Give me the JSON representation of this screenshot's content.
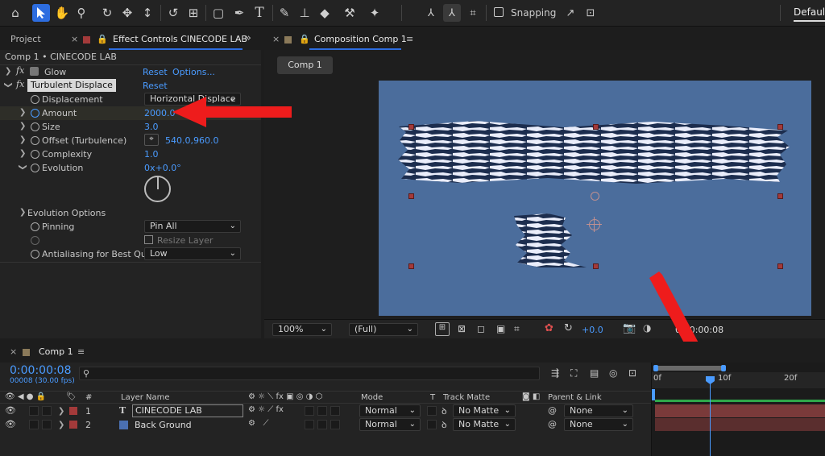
{
  "toolbar": {
    "snapping_label": "Snapping",
    "workspace": "Default",
    "tools": [
      "home-icon",
      "selection-icon",
      "hand-icon",
      "zoom-icon",
      "orbit-icon",
      "pan-icon",
      "dolly-icon",
      "rotate-icon",
      "pan-behind-icon",
      "rectangle-icon",
      "pen-icon",
      "type-icon",
      "brush-icon",
      "clone-stamp-icon",
      "eraser-icon",
      "roto-icon",
      "puppet-icon"
    ]
  },
  "left_panel": {
    "tab_project": "Project",
    "tab_effect": "Effect Controls CINECODE LAB",
    "breadcrumb": "Comp 1 • CINECODE LAB",
    "effects": [
      {
        "name": "Glow",
        "reset": "Reset",
        "options": "Options..."
      },
      {
        "name": "Turbulent Displace",
        "reset": "Reset"
      }
    ],
    "props": {
      "displacement_label": "Displacement",
      "displacement_value": "Horizontal Displace",
      "amount_label": "Amount",
      "amount_value": "2000.0",
      "size_label": "Size",
      "size_value": "3.0",
      "offset_label": "Offset (Turbulence)",
      "offset_value": "540.0,960.0",
      "complexity_label": "Complexity",
      "complexity_value": "1.0",
      "evolution_label": "Evolution",
      "evolution_value": "0x+0.0°",
      "evolution_options_label": "Evolution Options",
      "pinning_label": "Pinning",
      "pinning_value": "Pin All",
      "resize_layer_label": "Resize Layer",
      "antialiasing_label": "Antialiasing for Best Quali",
      "antialiasing_value": "Low"
    }
  },
  "comp_panel": {
    "tab_label": "Composition Comp 1",
    "sub_tab": "Comp 1",
    "zoom": "100%",
    "resolution": "(Full)",
    "exposure": "+0.0",
    "timecode": "0:00:00:08"
  },
  "timeline": {
    "tab_label": "Comp 1",
    "timecode": "0:00:00:08",
    "frame_info": "00008 (30.00 fps)",
    "search_placeholder": "",
    "headers": {
      "hash": "#",
      "layer_name": "Layer Name",
      "mode": "Mode",
      "t": "T",
      "track_matte": "Track Matte",
      "parent": "Parent & Link"
    },
    "ruler": [
      "0f",
      "10f",
      "20f"
    ],
    "layers": [
      {
        "num": "1",
        "type": "T",
        "name": "CINECODE LAB",
        "mode": "Normal",
        "matte": "No Matte",
        "parent": "None",
        "color": "#a33a3a"
      },
      {
        "num": "2",
        "type": "",
        "name": "Back Ground",
        "mode": "Normal",
        "matte": "No Matte",
        "parent": "None",
        "color": "#4a6fb0"
      }
    ]
  }
}
